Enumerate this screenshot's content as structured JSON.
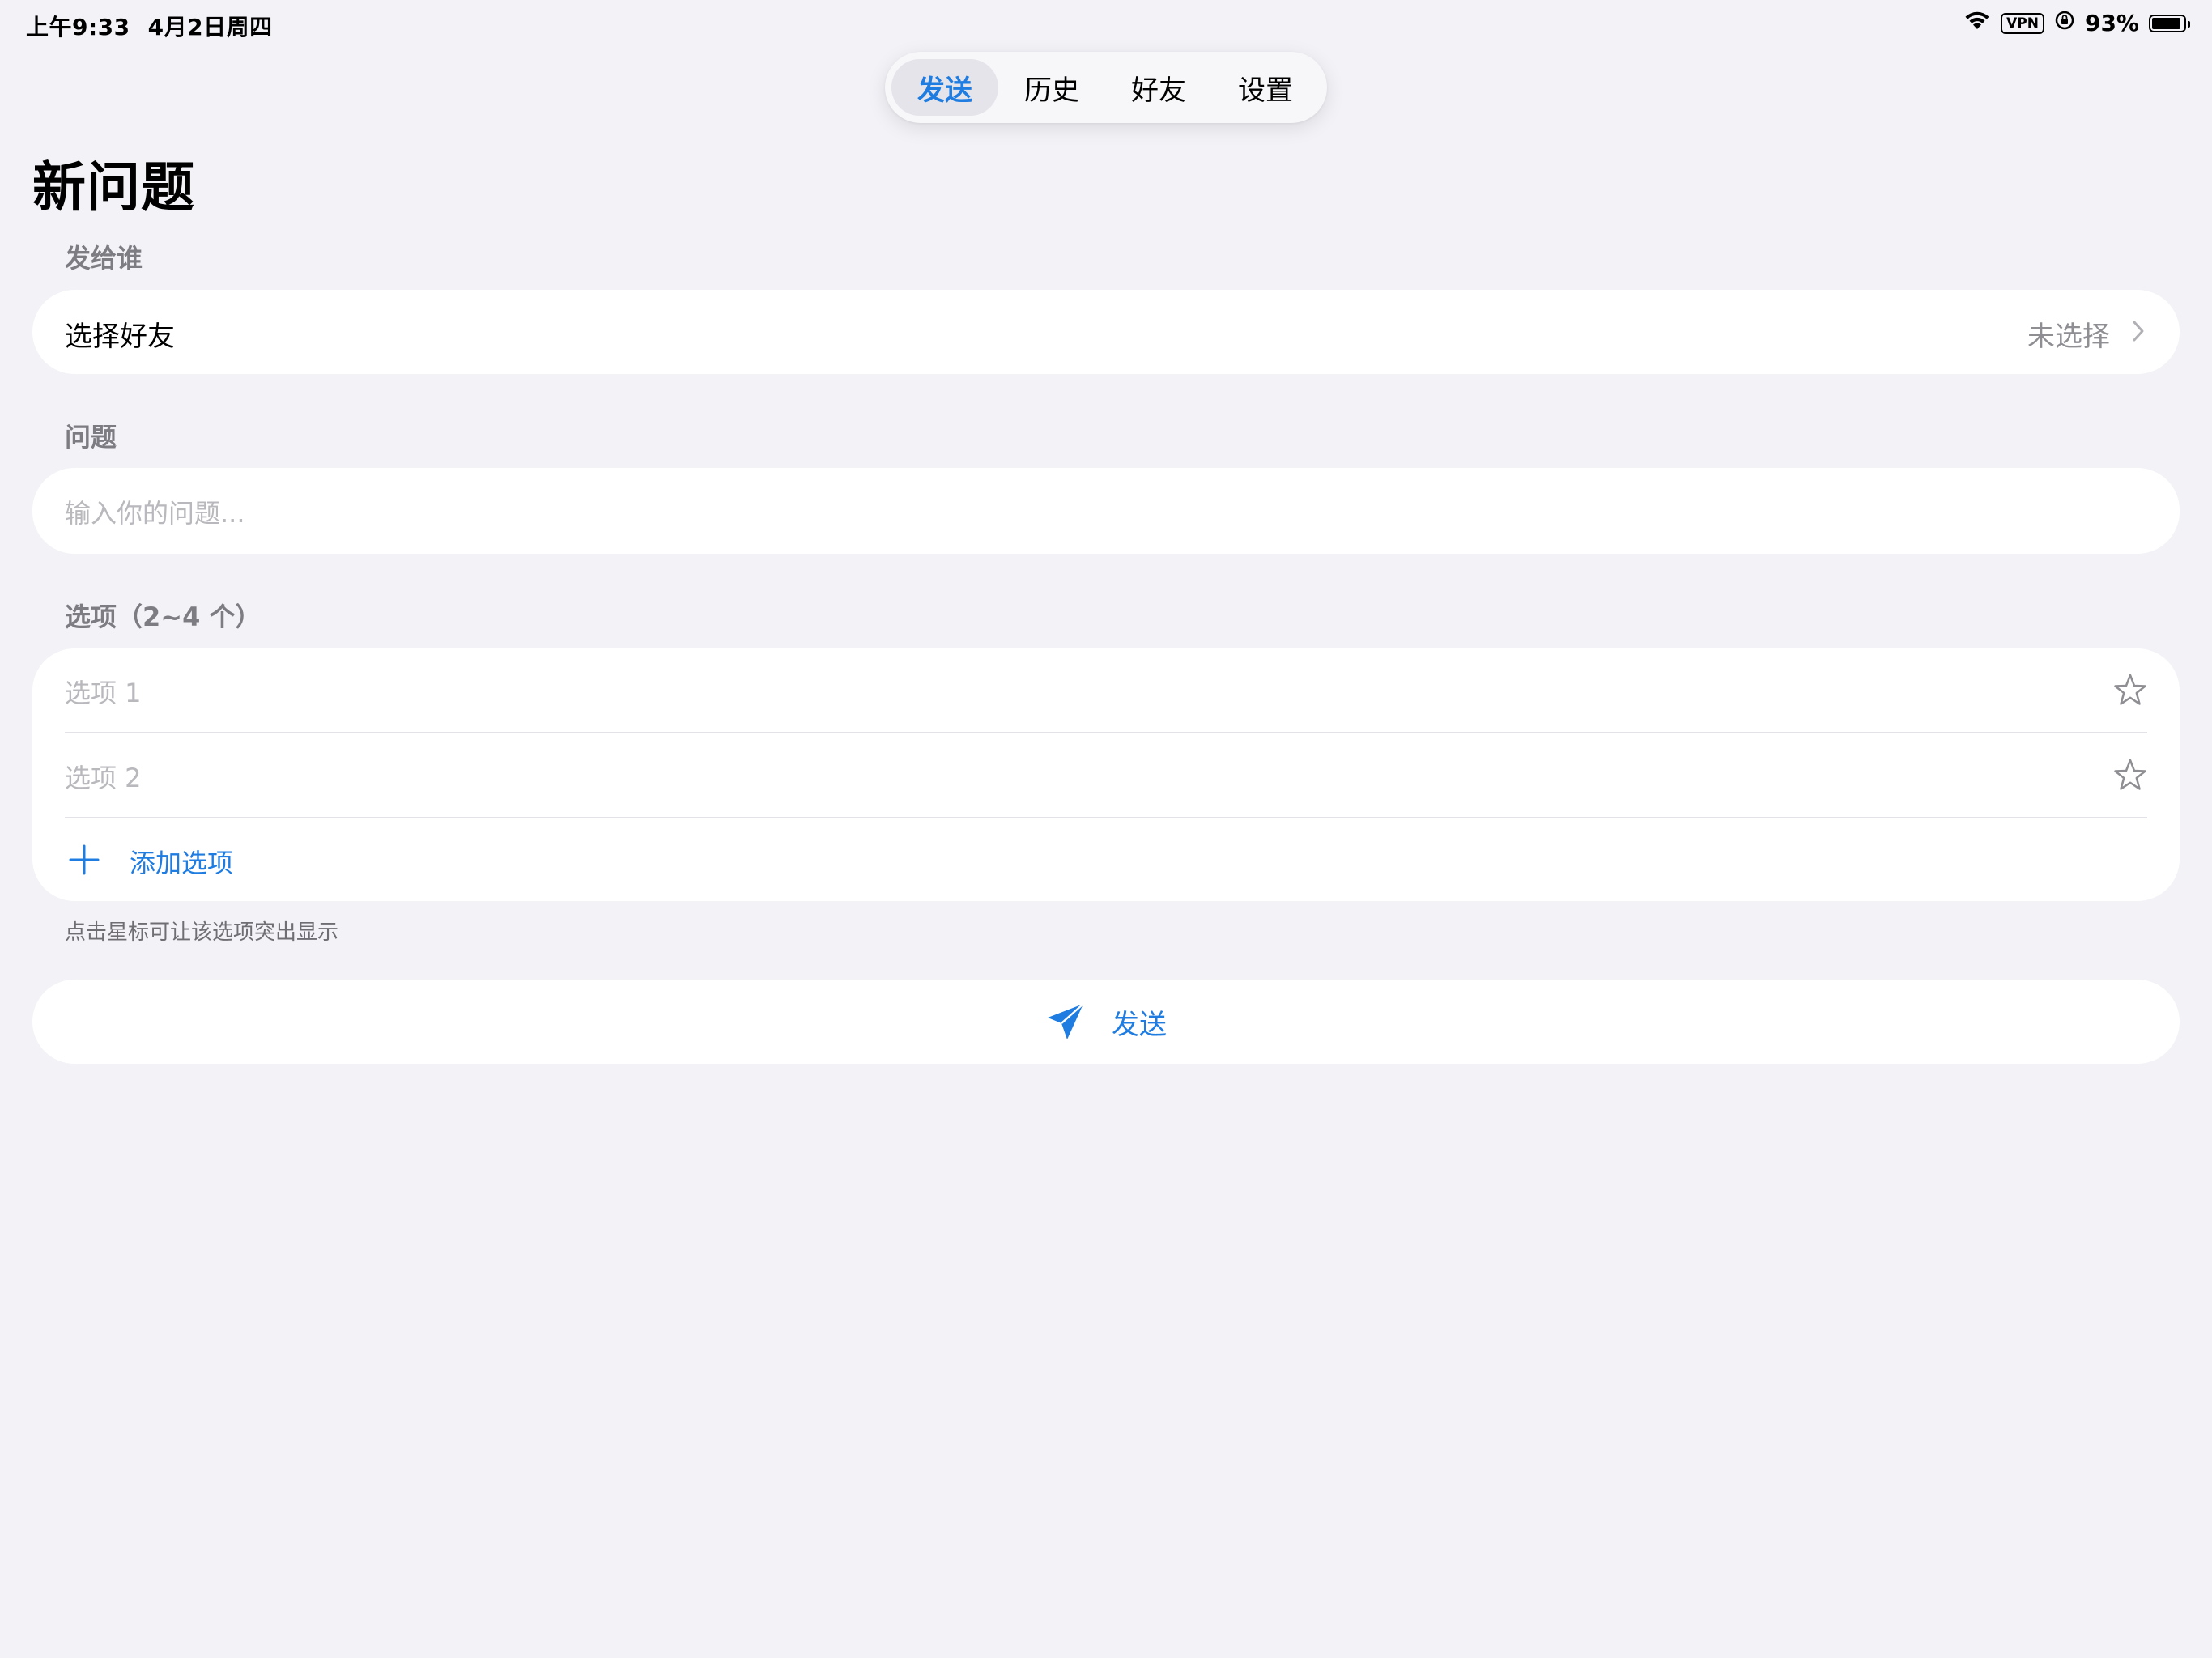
{
  "status_bar": {
    "time": "上午9:33",
    "date": "4月2日周四",
    "vpn": "VPN",
    "battery": "93%",
    "battery_level": 0.93
  },
  "tabs": [
    {
      "label": "发送",
      "active": true
    },
    {
      "label": "历史",
      "active": false
    },
    {
      "label": "好友",
      "active": false
    },
    {
      "label": "设置",
      "active": false
    }
  ],
  "page": {
    "title": "新问题"
  },
  "recipient": {
    "section_label": "发给谁",
    "row_label": "选择好友",
    "value": "未选择",
    "icon": "chevron-right-icon"
  },
  "question": {
    "section_label": "问题",
    "placeholder": "输入你的问题..."
  },
  "options": {
    "section_label": "选项（2~4 个）",
    "items": [
      {
        "placeholder": "选项 1",
        "icon": "star-icon"
      },
      {
        "placeholder": "选项 2",
        "icon": "star-icon"
      }
    ],
    "add_label": "添加选项",
    "hint": "点击星标可让该选项突出显示"
  },
  "send_button": {
    "label": "发送",
    "icon": "paperplane-icon"
  },
  "colors": {
    "accent": "#1f7ce0",
    "background": "#f2f2f7",
    "card": "#ffffff",
    "secondary_text": "#7c7c82",
    "placeholder": "#b8b8bd"
  }
}
